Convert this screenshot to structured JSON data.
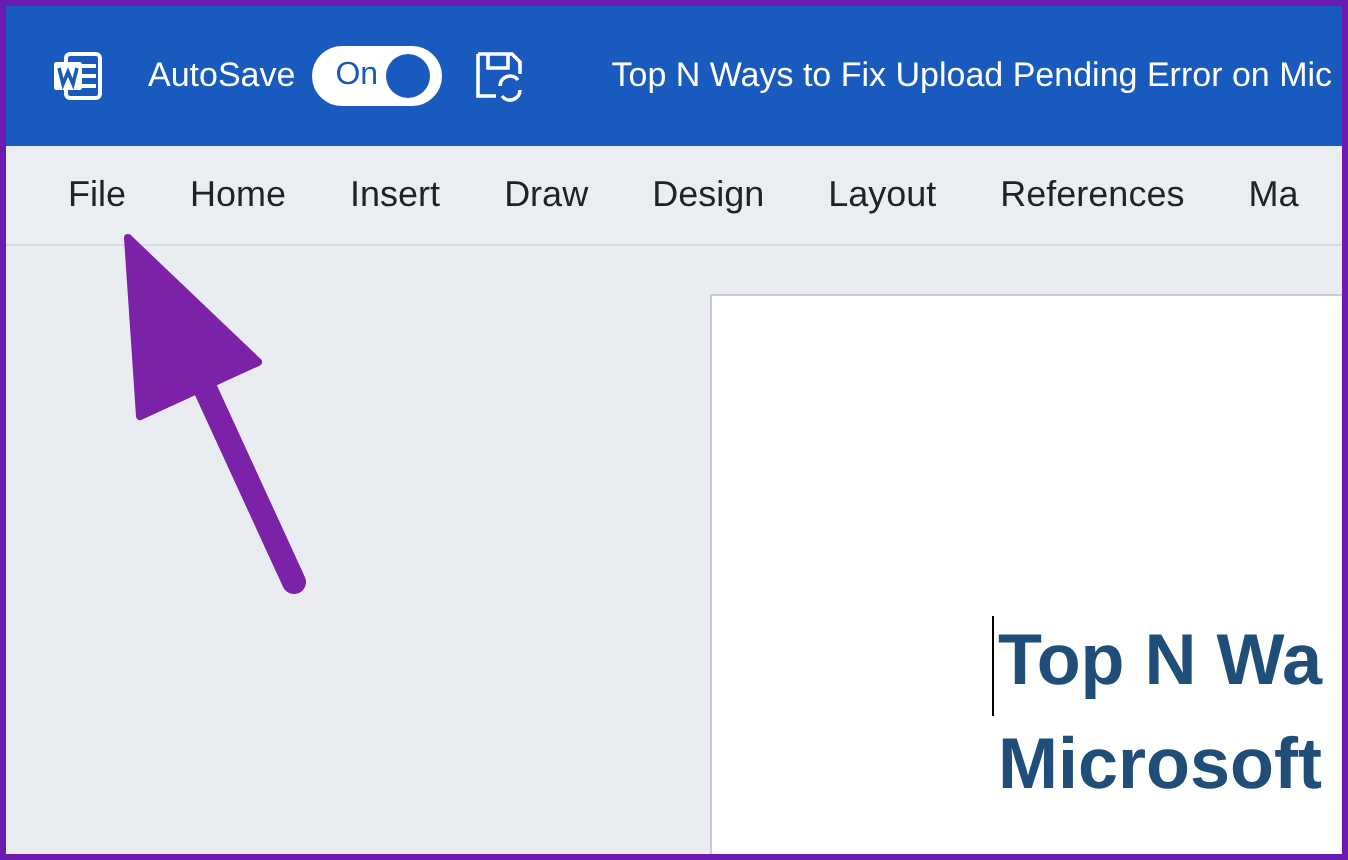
{
  "title_bar": {
    "autosave_label": "AutoSave",
    "autosave_toggle": {
      "label": "On",
      "on": true
    },
    "document_title": "Top N Ways to Fix Upload Pending Error on Mic"
  },
  "ribbon_tabs": [
    {
      "label": "File"
    },
    {
      "label": "Home"
    },
    {
      "label": "Insert"
    },
    {
      "label": "Draw"
    },
    {
      "label": "Design"
    },
    {
      "label": "Layout"
    },
    {
      "label": "References"
    },
    {
      "label": "Ma"
    }
  ],
  "document": {
    "heading_lines": [
      "Top N Wa",
      "Microsoft"
    ]
  }
}
